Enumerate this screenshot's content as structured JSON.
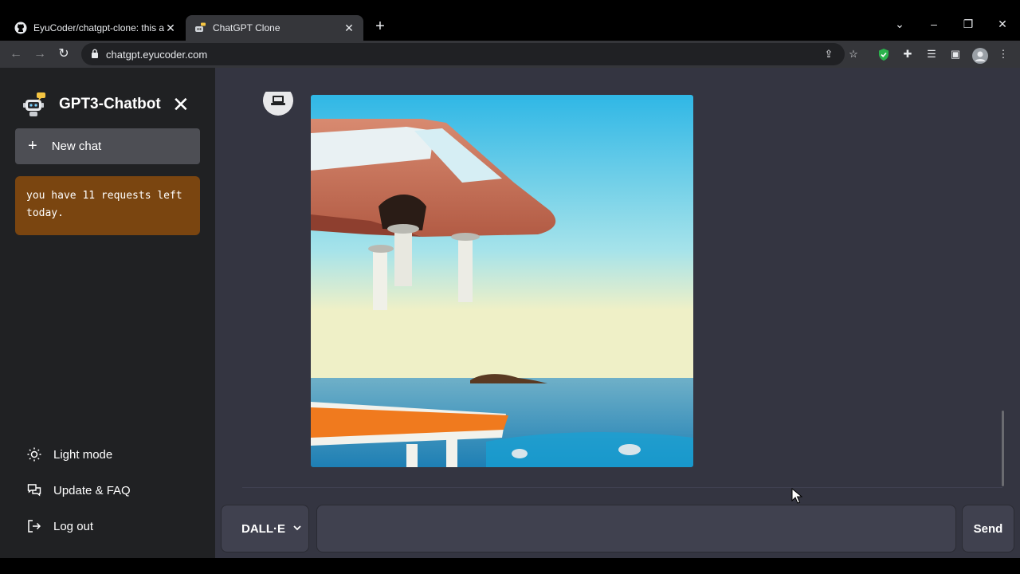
{
  "browser": {
    "tabs": [
      {
        "title": "EyuCoder/chatgpt-clone: this app"
      },
      {
        "title": "ChatGPT Clone"
      }
    ],
    "url": "chatgpt.eyucoder.com"
  },
  "sidebar": {
    "brand_title": "GPT3-Chatbot",
    "new_chat_label": "New chat",
    "quota_text": "you have 11 requests left today.",
    "items": [
      {
        "label": "Light mode",
        "icon": "sun-icon"
      },
      {
        "label": "Update & FAQ",
        "icon": "chat-icon"
      },
      {
        "label": "Log out",
        "icon": "logout-icon"
      }
    ]
  },
  "composer": {
    "model_selected": "DALL·E",
    "input_value": "",
    "send_label": "Send"
  },
  "colors": {
    "sidebar_bg": "#202123",
    "main_bg": "#343541",
    "quota_bg": "#7a4510",
    "new_chat_bg": "#4d4e54"
  }
}
